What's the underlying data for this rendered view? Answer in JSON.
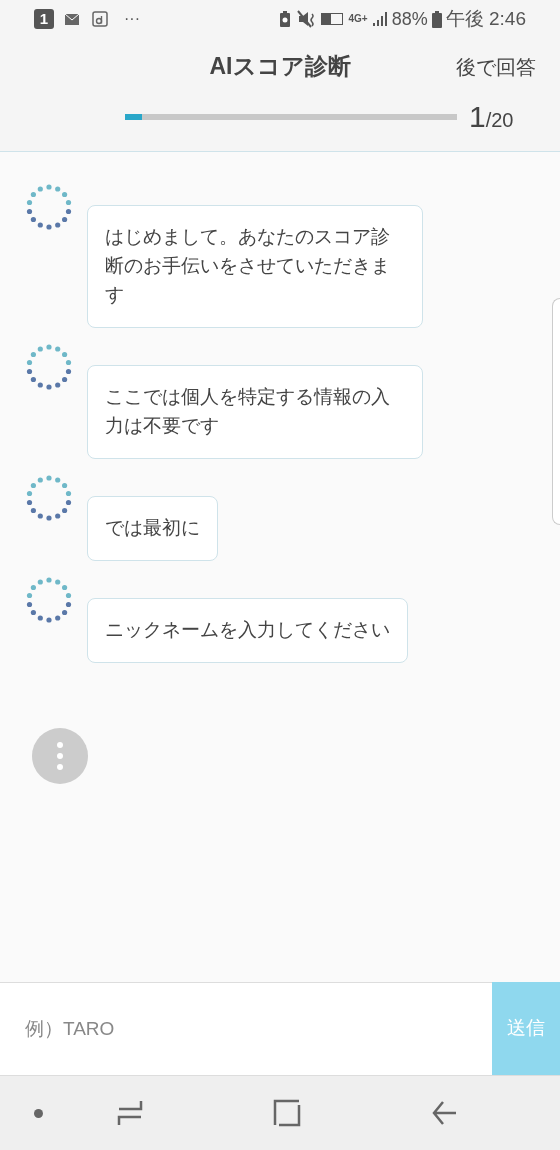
{
  "status_bar": {
    "notification_badge": "1",
    "more": "···",
    "network": "4G+",
    "battery": "88%",
    "time": "午後 2:46"
  },
  "header": {
    "title": "AIスコア診断",
    "later_button": "後で回答",
    "progress": {
      "level": 0.05,
      "current": "1",
      "total": "/20"
    }
  },
  "messages": [
    {
      "text": "はじめまして。あなたのスコア診断のお手伝いをさせていただきます"
    },
    {
      "text": "ここでは個人を特定する情報の入力は不要です"
    },
    {
      "text": "では最初に"
    },
    {
      "text": "ニックネームを入力してください"
    }
  ],
  "typing_indicator": true,
  "input": {
    "placeholder": "例）TARO",
    "send_button": "送信"
  }
}
